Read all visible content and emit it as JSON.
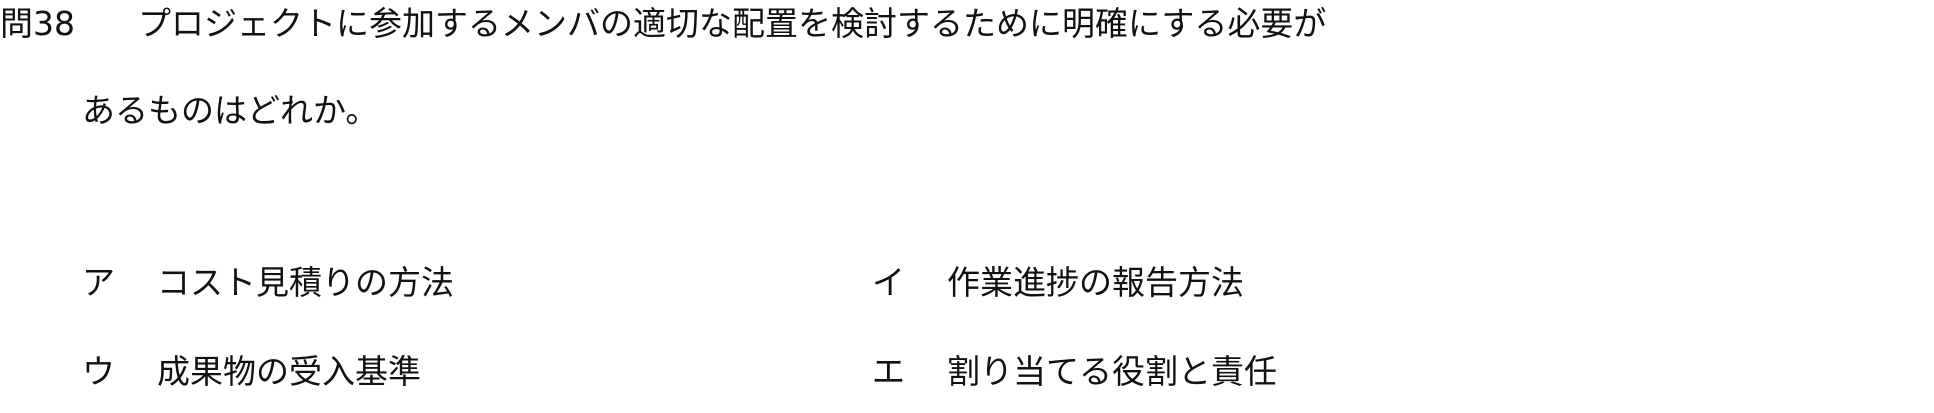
{
  "question": {
    "number": "問38",
    "line1": "プロジェクトに参加するメンバの適切な配置を検討するために明確にする必要が",
    "line2": "あるものはどれか。"
  },
  "choices": [
    {
      "mark": "ア",
      "text": "コスト見積りの方法"
    },
    {
      "mark": "イ",
      "text": "作業進捗の報告方法"
    },
    {
      "mark": "ウ",
      "text": "成果物の受入基準"
    },
    {
      "mark": "エ",
      "text": "割り当てる役割と責任"
    }
  ]
}
